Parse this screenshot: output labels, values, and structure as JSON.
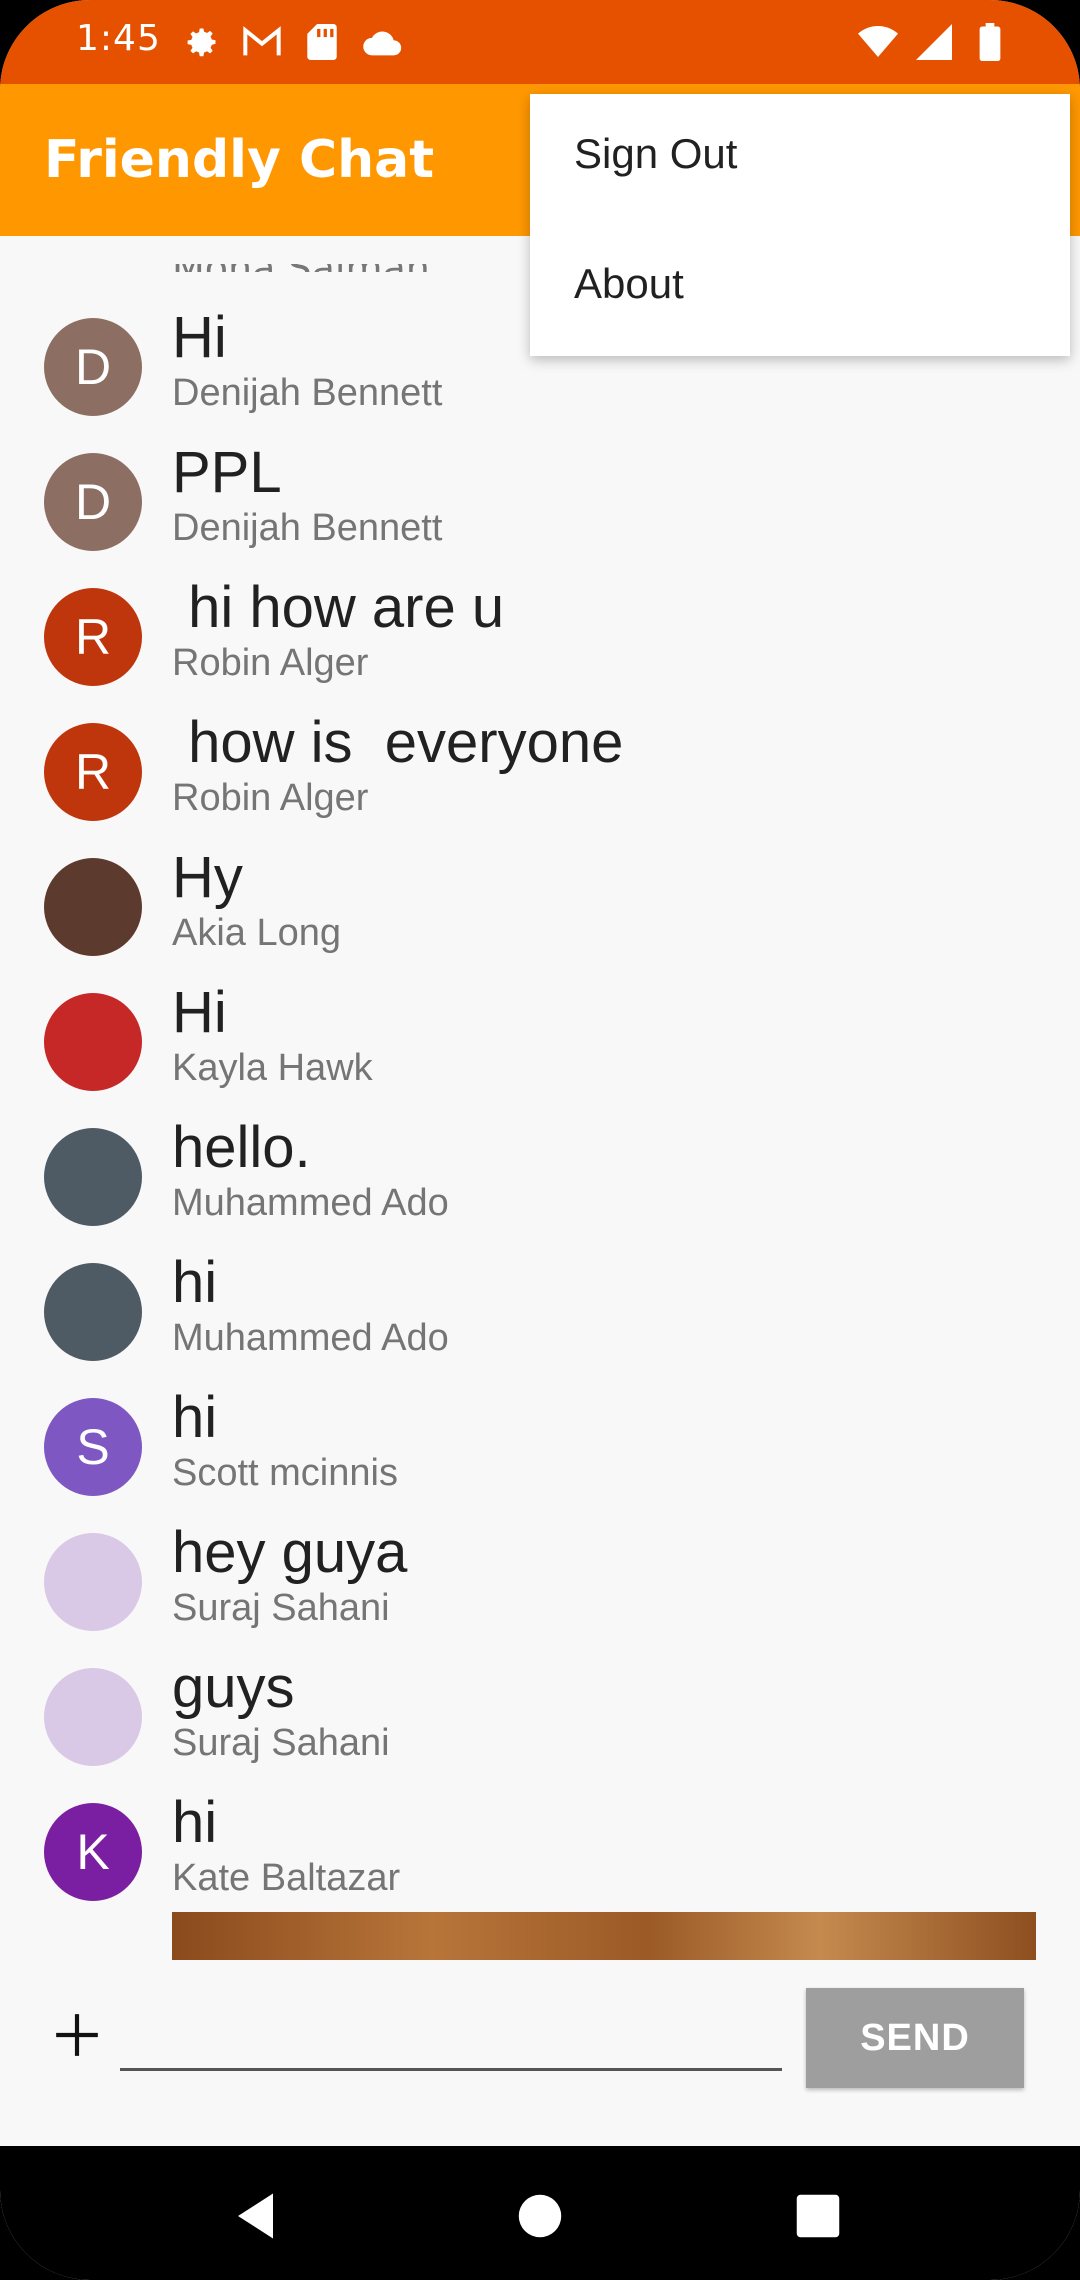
{
  "status_bar": {
    "time": "1:45",
    "left_icons": [
      "gear-icon",
      "gmail-icon",
      "sd-card-icon",
      "cloud-icon"
    ],
    "right_icons": [
      "wifi-icon",
      "signal-icon",
      "battery-icon"
    ]
  },
  "app_bar": {
    "title": "Friendly Chat",
    "color": "#ff9800",
    "status_color": "#e65100"
  },
  "menu": {
    "items": [
      {
        "label": "Sign Out"
      },
      {
        "label": "About"
      }
    ]
  },
  "messages": [
    {
      "text": "Hi",
      "author": "Denijah Bennett",
      "avatar_letter": "D",
      "avatar_color": "#8d6e63"
    },
    {
      "text": "PPL",
      "author": "Denijah Bennett",
      "avatar_letter": "D",
      "avatar_color": "#8d6e63"
    },
    {
      "text": " hi how are u",
      "author": "Robin Alger",
      "avatar_letter": "R",
      "avatar_color": "#bf360c"
    },
    {
      "text": " how is  everyone",
      "author": "Robin Alger",
      "avatar_letter": "R",
      "avatar_color": "#bf360c"
    },
    {
      "text": "Hy",
      "author": "Akia Long",
      "avatar_letter": "",
      "avatar_color": "#5d3a2e"
    },
    {
      "text": "Hi",
      "author": "Kayla Hawk",
      "avatar_letter": "",
      "avatar_color": "#c62828"
    },
    {
      "text": "hello.",
      "author": "Muhammed Ado",
      "avatar_letter": "",
      "avatar_color": "#4e5a64"
    },
    {
      "text": "hi",
      "author": "Muhammed Ado",
      "avatar_letter": "",
      "avatar_color": "#4e5a64"
    },
    {
      "text": "hi",
      "author": "Scott mcinnis",
      "avatar_letter": "S",
      "avatar_color": "#7e57c2"
    },
    {
      "text": "hey guya",
      "author": "Suraj Sahani",
      "avatar_letter": "",
      "avatar_color": "#d9c8e6"
    },
    {
      "text": "guys",
      "author": "Suraj Sahani",
      "avatar_letter": "",
      "avatar_color": "#d9c8e6"
    },
    {
      "text": "hi",
      "author": "Kate Baltazar",
      "avatar_letter": "K",
      "avatar_color": "#7b1fa2"
    }
  ],
  "composer": {
    "placeholder": "",
    "send_label": "SEND"
  }
}
